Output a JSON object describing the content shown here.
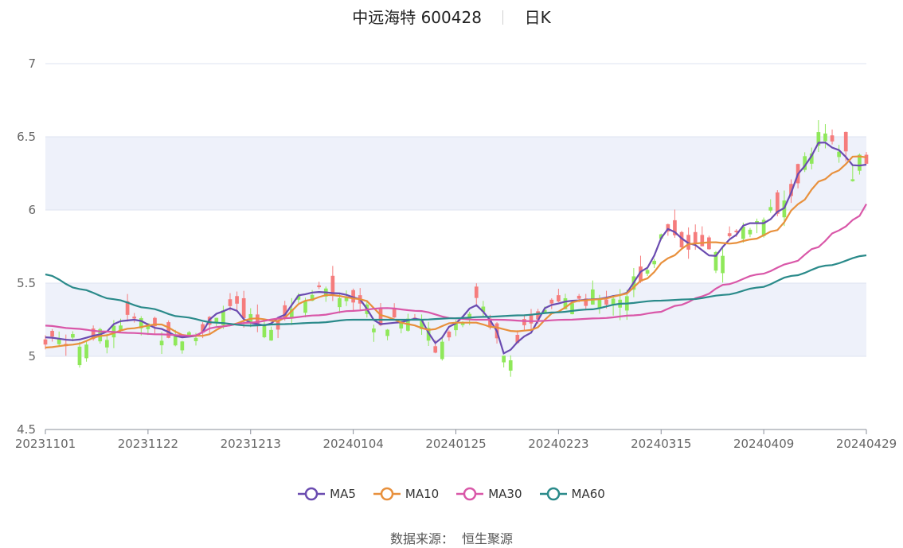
{
  "title": {
    "stock_name": "中远海特",
    "stock_code": "600428",
    "period": "日K"
  },
  "colors": {
    "up": "#f57c7c",
    "down": "#8fe85a",
    "MA5": "#6a4bb0",
    "MA10": "#e8903c",
    "MA30": "#d957a8",
    "MA60": "#2a8a8a",
    "band": "#eef1fa",
    "grid": "#dde3f0",
    "axis": "#8a8f9a"
  },
  "legend": [
    {
      "name": "MA5",
      "color_key": "MA5"
    },
    {
      "name": "MA10",
      "color_key": "MA10"
    },
    {
      "name": "MA30",
      "color_key": "MA30"
    },
    {
      "name": "MA60",
      "color_key": "MA60"
    }
  ],
  "source": {
    "label": "数据来源：",
    "value": "恒生聚源"
  },
  "chart_data": {
    "type": "candlestick",
    "ylim": [
      4.5,
      7
    ],
    "y_ticks": [
      4.5,
      5,
      5.5,
      6,
      6.5,
      7
    ],
    "x_tick_labels": [
      "20231101",
      "20231122",
      "20231213",
      "20240104",
      "20240125",
      "20240223",
      "20240315",
      "20240409",
      "20240429"
    ],
    "x_tick_index": [
      0,
      15,
      30,
      45,
      60,
      75,
      90,
      105,
      120
    ],
    "n_points": 121,
    "ma_series": [
      {
        "name": "MA5",
        "keys": [
          [
            0,
            5.13
          ],
          [
            5,
            5.11
          ],
          [
            10,
            5.15
          ],
          [
            13,
            5.24
          ],
          [
            16,
            5.25
          ],
          [
            20,
            5.19
          ],
          [
            24,
            5.13
          ],
          [
            27,
            5.14
          ],
          [
            30,
            5.29
          ],
          [
            33,
            5.33
          ],
          [
            36,
            5.23
          ],
          [
            39,
            5.21
          ],
          [
            42,
            5.28
          ],
          [
            45,
            5.42
          ],
          [
            48,
            5.44
          ],
          [
            52,
            5.43
          ],
          [
            55,
            5.4
          ],
          [
            59,
            5.22
          ],
          [
            62,
            5.23
          ],
          [
            66,
            5.26
          ],
          [
            69,
            5.09
          ],
          [
            72,
            5.22
          ],
          [
            76,
            5.35
          ],
          [
            79,
            5.24
          ],
          [
            81,
            5.02
          ],
          [
            85,
            5.14
          ],
          [
            89,
            5.35
          ],
          [
            93,
            5.38
          ],
          [
            97,
            5.39
          ],
          [
            102,
            5.42
          ],
          [
            106,
            5.6
          ],
          [
            110,
            5.87
          ],
          [
            114,
            5.77
          ],
          [
            118,
            5.68
          ],
          [
            121,
            5.8
          ],
          [
            124,
            5.91
          ],
          [
            127,
            5.91
          ],
          [
            130,
            6.0
          ],
          [
            134,
            6.3
          ],
          [
            137,
            6.47
          ],
          [
            140,
            6.41
          ],
          [
            143,
            6.3
          ],
          [
            145,
            6.31
          ]
        ]
      },
      {
        "name": "MA10",
        "keys": [
          [
            0,
            5.06
          ],
          [
            5,
            5.08
          ],
          [
            10,
            5.14
          ],
          [
            15,
            5.19
          ],
          [
            20,
            5.22
          ],
          [
            25,
            5.14
          ],
          [
            28,
            5.14
          ],
          [
            32,
            5.21
          ],
          [
            37,
            5.26
          ],
          [
            41,
            5.24
          ],
          [
            46,
            5.38
          ],
          [
            50,
            5.42
          ],
          [
            56,
            5.39
          ],
          [
            60,
            5.27
          ],
          [
            64,
            5.22
          ],
          [
            68,
            5.18
          ],
          [
            72,
            5.23
          ],
          [
            76,
            5.23
          ],
          [
            79,
            5.2
          ],
          [
            83,
            5.17
          ],
          [
            86,
            5.18
          ],
          [
            90,
            5.3
          ],
          [
            94,
            5.38
          ],
          [
            98,
            5.39
          ],
          [
            102,
            5.42
          ],
          [
            106,
            5.53
          ],
          [
            110,
            5.67
          ],
          [
            114,
            5.77
          ],
          [
            118,
            5.78
          ],
          [
            121,
            5.77
          ],
          [
            125,
            5.8
          ],
          [
            129,
            5.86
          ],
          [
            133,
            6.04
          ],
          [
            137,
            6.2
          ],
          [
            140,
            6.27
          ],
          [
            143,
            6.37
          ],
          [
            145,
            6.36
          ]
        ]
      },
      {
        "name": "MA30",
        "keys": [
          [
            0,
            5.21
          ],
          [
            5,
            5.19
          ],
          [
            10,
            5.17
          ],
          [
            15,
            5.16
          ],
          [
            20,
            5.15
          ],
          [
            26,
            5.14
          ],
          [
            30,
            5.2
          ],
          [
            36,
            5.23
          ],
          [
            42,
            5.26
          ],
          [
            48,
            5.28
          ],
          [
            54,
            5.31
          ],
          [
            60,
            5.33
          ],
          [
            66,
            5.31
          ],
          [
            72,
            5.26
          ],
          [
            76,
            5.25
          ],
          [
            80,
            5.25
          ],
          [
            86,
            5.24
          ],
          [
            92,
            5.25
          ],
          [
            98,
            5.26
          ],
          [
            104,
            5.28
          ],
          [
            108,
            5.3
          ],
          [
            112,
            5.35
          ],
          [
            116,
            5.41
          ],
          [
            120,
            5.49
          ],
          [
            126,
            5.56
          ],
          [
            132,
            5.64
          ],
          [
            136,
            5.74
          ],
          [
            140,
            5.86
          ],
          [
            144,
            5.96
          ],
          [
            145,
            6.04
          ]
        ]
      },
      {
        "name": "MA60",
        "keys": [
          [
            0,
            5.56
          ],
          [
            6,
            5.46
          ],
          [
            12,
            5.39
          ],
          [
            18,
            5.33
          ],
          [
            24,
            5.27
          ],
          [
            30,
            5.23
          ],
          [
            36,
            5.21
          ],
          [
            42,
            5.22
          ],
          [
            48,
            5.23
          ],
          [
            54,
            5.25
          ],
          [
            60,
            5.25
          ],
          [
            66,
            5.25
          ],
          [
            72,
            5.26
          ],
          [
            78,
            5.27
          ],
          [
            84,
            5.28
          ],
          [
            90,
            5.3
          ],
          [
            96,
            5.32
          ],
          [
            102,
            5.36
          ],
          [
            108,
            5.38
          ],
          [
            114,
            5.39
          ],
          [
            120,
            5.42
          ],
          [
            126,
            5.47
          ],
          [
            132,
            5.55
          ],
          [
            138,
            5.62
          ],
          [
            145,
            5.69
          ]
        ]
      }
    ]
  }
}
